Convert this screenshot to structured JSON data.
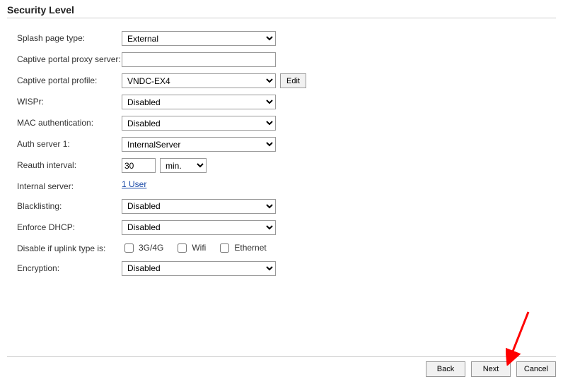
{
  "title": "Security Level",
  "labels": {
    "splash_page_type": "Splash page type:",
    "proxy_server": "Captive portal proxy server:",
    "profile": "Captive portal profile:",
    "wispr": "WISPr:",
    "mac_auth": "MAC authentication:",
    "auth_server1": "Auth server 1:",
    "reauth": "Reauth interval:",
    "internal_server": "Internal server:",
    "blacklisting": "Blacklisting:",
    "enforce_dhcp": "Enforce DHCP:",
    "disable_uplink": "Disable if uplink type is:",
    "encryption": "Encryption:"
  },
  "values": {
    "splash_page_type": "External",
    "proxy_server": "",
    "profile": "VNDC-EX4",
    "wispr": "Disabled",
    "mac_auth": "Disabled",
    "auth_server1": "InternalServer",
    "reauth_value": "30",
    "reauth_unit": "min.",
    "internal_link": "1 User",
    "blacklisting": "Disabled",
    "enforce_dhcp": "Disabled",
    "encryption": "Disabled"
  },
  "uplink": {
    "opt1": "3G/4G",
    "opt2": "Wifi",
    "opt3": "Ethernet"
  },
  "buttons": {
    "edit": "Edit",
    "back": "Back",
    "next": "Next",
    "cancel": "Cancel"
  }
}
